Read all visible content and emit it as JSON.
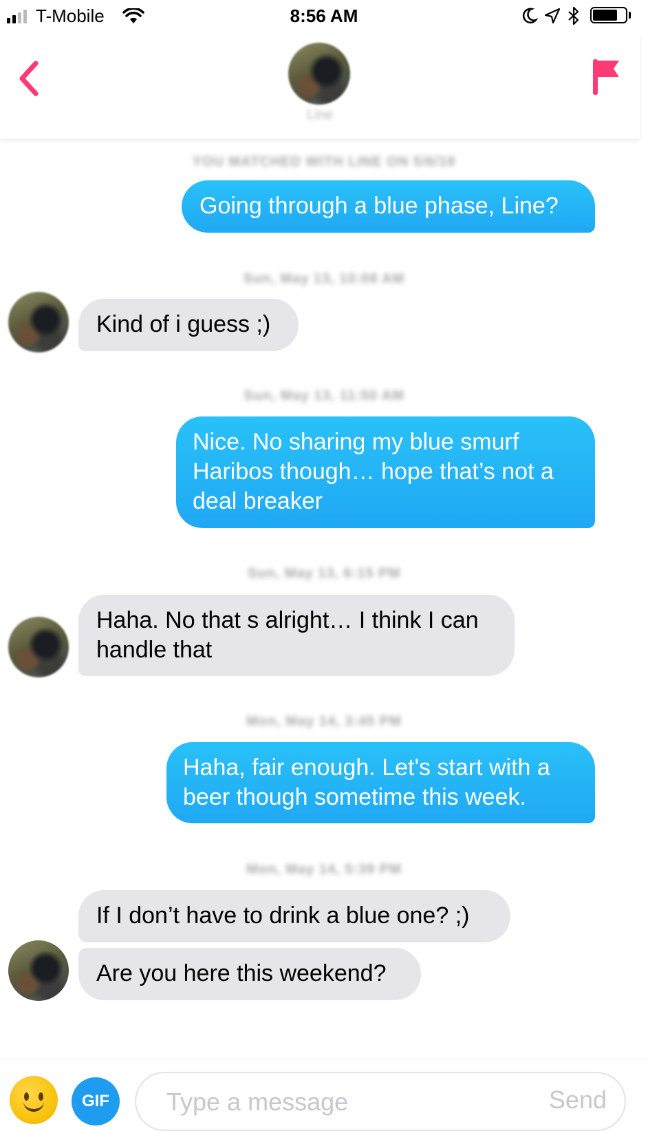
{
  "status_bar": {
    "carrier": "T-Mobile",
    "time": "8:56 AM",
    "battery_level": 0.75
  },
  "header": {
    "match_name": "Line",
    "back_icon": "chevron-left-icon",
    "flag_icon": "flag-icon",
    "accent_color": "#fd3a73"
  },
  "chat": {
    "match_banner": "YOU MATCHED WITH LINE ON 5/6/18",
    "timestamps": [
      "Sun, May 13, 10:08 AM",
      "Sun, May 13, 11:50 AM",
      "Sun, May 13, 6:15 PM",
      "Mon, May 14, 3:45 PM",
      "Mon, May 14, 5:39 PM"
    ],
    "messages": [
      {
        "from": "me",
        "text": "Going through a blue phase, Line?"
      },
      {
        "from": "them",
        "text": "Kind of i guess ;)"
      },
      {
        "from": "me",
        "text": "Nice. No sharing my blue smurf Haribos though… hope that’s not a deal breaker"
      },
      {
        "from": "them",
        "text": "Haha. No that s alright… I think I can handle that"
      },
      {
        "from": "me",
        "text": "Haha, fair enough. Let's start with a beer though sometime this week."
      },
      {
        "from": "them",
        "text": "If I don’t have to drink a blue one? ;)"
      },
      {
        "from": "them",
        "text": "Are you here this weekend?"
      }
    ],
    "outgoing_color": "#21b0f5",
    "incoming_color": "#e5e5ea"
  },
  "composer": {
    "placeholder": "Type a message",
    "send_label": "Send",
    "gif_label": "GIF",
    "emoji_icon": "smiley-face-icon"
  }
}
